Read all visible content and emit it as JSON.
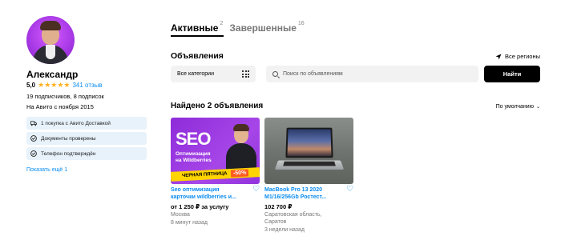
{
  "profile": {
    "name": "Александр",
    "rating": "5,0",
    "stars": "★★★★★",
    "reviews": "341 отзыв",
    "subscribers": "19 подписчиков, 8 подписок",
    "since": "На Авито с ноября 2015",
    "badges": [
      {
        "icon": "truck-icon",
        "label": "1 покупка с Авито Доставкой"
      },
      {
        "icon": "document-check-icon",
        "label": "Документы проверены"
      },
      {
        "icon": "phone-check-icon",
        "label": "Телефон подтверждён"
      }
    ],
    "show_more": "Показать ещё 1"
  },
  "tabs": [
    {
      "label": "Активные",
      "count": "2",
      "active": true
    },
    {
      "label": "Завершенные",
      "count": "16",
      "active": false
    }
  ],
  "listings": {
    "section_title": "Объявления",
    "region": "Все регионы",
    "category_select": "Все категории",
    "search_placeholder": "Поиск по объявлениям",
    "find_button": "Найти",
    "found_title": "Найдено 2 объявления",
    "sort": "По умолчанию"
  },
  "cards": [
    {
      "title_line1": "Seo оптимизация",
      "title_line2": "карточки wildberries и...",
      "price": "от 1 250 ₽ за услугу",
      "location": "Москва",
      "time": "8 минут назад",
      "image": {
        "big": "SEO",
        "sub1": "Оптимизация",
        "sub2": "на Wildberries",
        "strip": "ЧЕРНАЯ ПЯТНИЦА",
        "discount": "-50%"
      }
    },
    {
      "title_line1": "MacBook Pro 13 2020",
      "title_line2": "M1/16/256Gb Ростест...",
      "price": "102 700 ₽",
      "location_line1": "Саратовская область,",
      "location_line2": "Саратов",
      "time": "3 недели назад"
    }
  ],
  "colors": {
    "accent": "#0a8cf0",
    "badge_bg": "#e7f2fb",
    "star": "#ffb021",
    "button": "#000000"
  }
}
